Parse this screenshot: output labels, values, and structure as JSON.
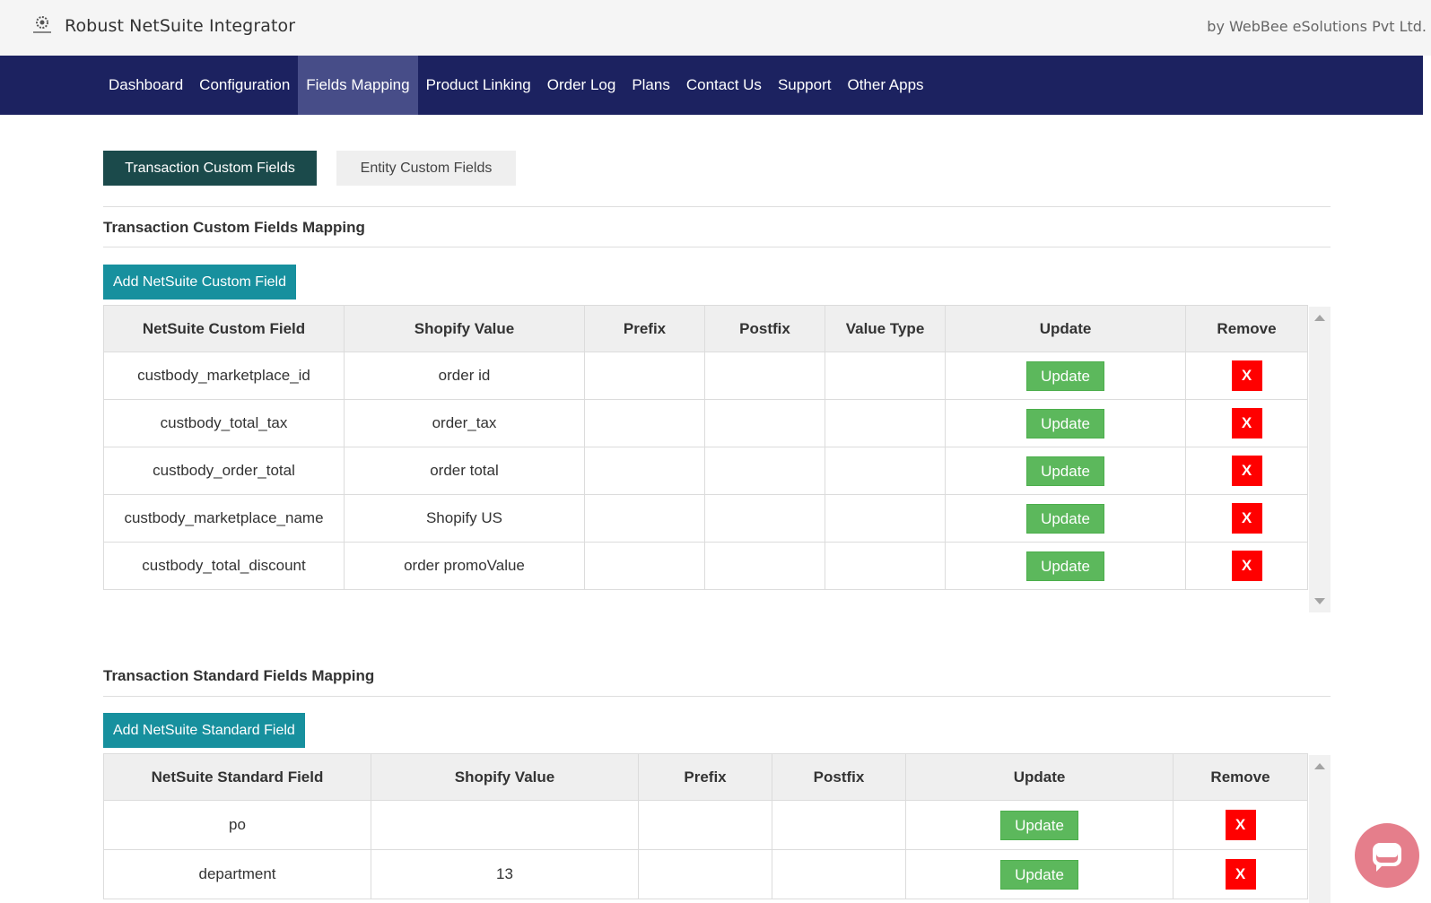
{
  "header": {
    "app_title": "Robust NetSuite Integrator",
    "company": "by WebBee eSolutions Pvt Ltd.",
    "logo_icon": "gear-logo-icon"
  },
  "nav": {
    "items": [
      {
        "label": "Dashboard"
      },
      {
        "label": "Configuration"
      },
      {
        "label": "Fields Mapping",
        "active": true
      },
      {
        "label": "Product Linking"
      },
      {
        "label": "Order Log"
      },
      {
        "label": "Plans"
      },
      {
        "label": "Contact Us"
      },
      {
        "label": "Support"
      },
      {
        "label": "Other Apps"
      }
    ]
  },
  "tabs": {
    "transaction": "Transaction Custom Fields",
    "entity": "Entity Custom Fields"
  },
  "custom_section": {
    "title": "Transaction Custom Fields Mapping",
    "add_button": "Add NetSuite Custom Field",
    "headers": [
      "NetSuite Custom Field",
      "Shopify Value",
      "Prefix",
      "Postfix",
      "Value Type",
      "Update",
      "Remove"
    ],
    "update_label": "Update",
    "remove_label": "X",
    "rows": [
      {
        "field": "custbody_marketplace_id",
        "value": "order id",
        "prefix": "",
        "postfix": "",
        "type": ""
      },
      {
        "field": "custbody_total_tax",
        "value": "order_tax",
        "prefix": "",
        "postfix": "",
        "type": ""
      },
      {
        "field": "custbody_order_total",
        "value": "order total",
        "prefix": "",
        "postfix": "",
        "type": ""
      },
      {
        "field": "custbody_marketplace_name",
        "value": "Shopify US",
        "prefix": "",
        "postfix": "",
        "type": ""
      },
      {
        "field": "custbody_total_discount",
        "value": "order promoValue",
        "prefix": "",
        "postfix": "",
        "type": ""
      }
    ]
  },
  "standard_section": {
    "title": "Transaction Standard Fields Mapping",
    "add_button": "Add NetSuite Standard Field",
    "headers": [
      "NetSuite Standard Field",
      "Shopify Value",
      "Prefix",
      "Postfix",
      "Update",
      "Remove"
    ],
    "update_label": "Update",
    "remove_label": "X",
    "rows": [
      {
        "field": "po",
        "value": "",
        "prefix": "",
        "postfix": ""
      },
      {
        "field": "department",
        "value": "13",
        "prefix": "",
        "postfix": ""
      }
    ]
  },
  "colors": {
    "nav_bg": "#1c2260",
    "nav_active": "#474d88",
    "active_tab": "#1b4a4b",
    "add_button": "#17909e",
    "update_button": "#5cb85c",
    "remove_button": "#ff0000",
    "chat_button": "#e57e8b"
  },
  "chat": {
    "icon": "chat-bubble-icon"
  }
}
